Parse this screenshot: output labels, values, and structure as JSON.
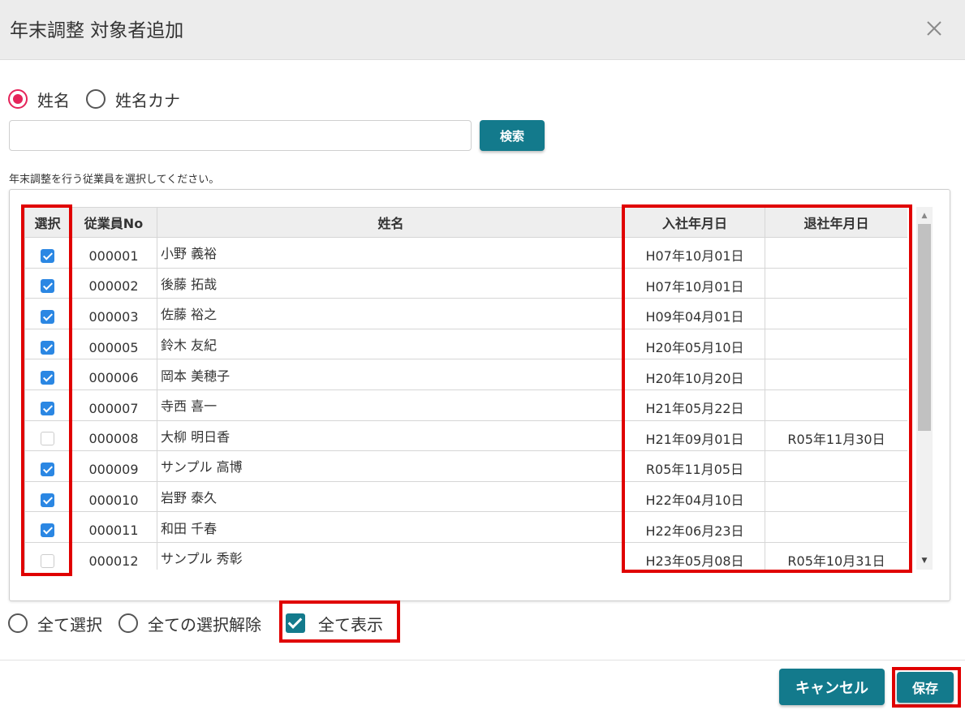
{
  "dialog": {
    "title": "年末調整 対象者追加",
    "close_icon": "close-icon"
  },
  "search": {
    "options": [
      {
        "label": "姓名",
        "selected": true
      },
      {
        "label": "姓名カナ",
        "selected": false
      }
    ],
    "input_value": "",
    "button_label": "検索"
  },
  "instruction": "年末調整を行う従業員を選択してください。",
  "table": {
    "columns": [
      "選択",
      "従業員No",
      "姓名",
      "入社年月日",
      "退社年月日"
    ],
    "rows": [
      {
        "checked": true,
        "no": "000001",
        "name": "小野 義裕",
        "hire": "H07年10月01日",
        "leave": ""
      },
      {
        "checked": true,
        "no": "000002",
        "name": "後藤 拓哉",
        "hire": "H07年10月01日",
        "leave": ""
      },
      {
        "checked": true,
        "no": "000003",
        "name": "佐藤 裕之",
        "hire": "H09年04月01日",
        "leave": ""
      },
      {
        "checked": true,
        "no": "000005",
        "name": "鈴木 友紀",
        "hire": "H20年05月10日",
        "leave": ""
      },
      {
        "checked": true,
        "no": "000006",
        "name": "岡本 美穂子",
        "hire": "H20年10月20日",
        "leave": ""
      },
      {
        "checked": true,
        "no": "000007",
        "name": "寺西 喜一",
        "hire": "H21年05月22日",
        "leave": ""
      },
      {
        "checked": false,
        "no": "000008",
        "name": "大柳 明日香",
        "hire": "H21年09月01日",
        "leave": "R05年11月30日"
      },
      {
        "checked": true,
        "no": "000009",
        "name": "サンプル 高博",
        "hire": "R05年11月05日",
        "leave": ""
      },
      {
        "checked": true,
        "no": "000010",
        "name": "岩野 泰久",
        "hire": "H22年04月10日",
        "leave": ""
      },
      {
        "checked": true,
        "no": "000011",
        "name": "和田 千春",
        "hire": "H22年06月23日",
        "leave": ""
      },
      {
        "checked": false,
        "no": "000012",
        "name": "サンプル 秀彰",
        "hire": "H23年05月08日",
        "leave": "R05年10月31日"
      }
    ]
  },
  "bottom": {
    "select_all_label": "全て選択",
    "deselect_all_label": "全ての選択解除",
    "show_all_label": "全て表示",
    "show_all_checked": true
  },
  "footer": {
    "cancel_label": "キャンセル",
    "save_label": "保存"
  },
  "colors": {
    "accent": "#137a8c",
    "radio_selected": "#e5245a",
    "checkbox": "#2b87e3",
    "highlight": "#e00000"
  }
}
